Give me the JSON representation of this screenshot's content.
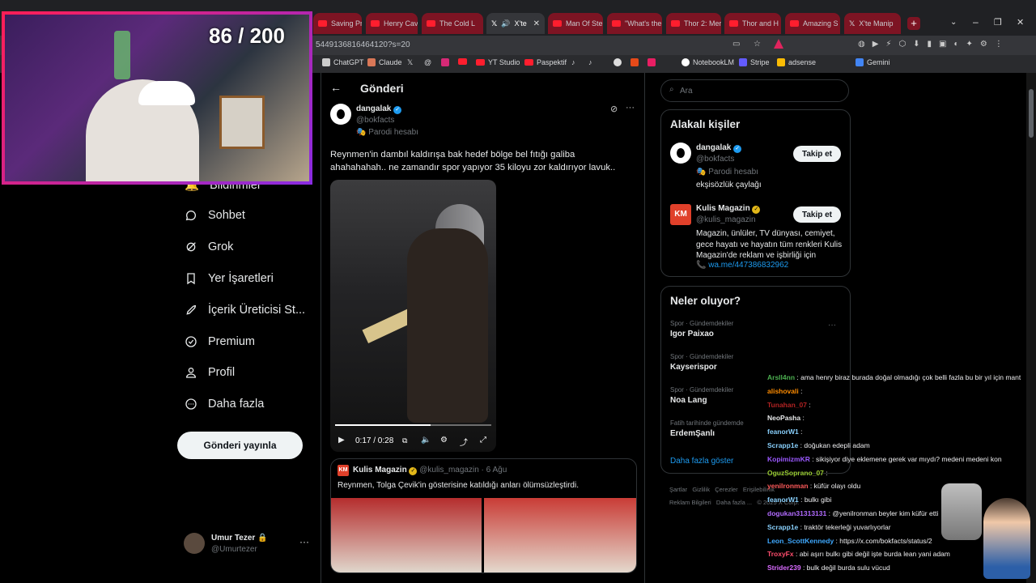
{
  "stream": {
    "counter": "86 / 200"
  },
  "tabs": [
    {
      "label": "Saving Priv",
      "type": "youtube"
    },
    {
      "label": "Henry Cavi",
      "type": "youtube"
    },
    {
      "label": "The Cold L",
      "type": "youtube"
    },
    {
      "label": "X'te",
      "type": "x",
      "active": true
    },
    {
      "label": "Man Of Ste",
      "type": "youtube"
    },
    {
      "label": "\"What's the",
      "type": "youtube"
    },
    {
      "label": "Thor 2: Mer",
      "type": "youtube"
    },
    {
      "label": "Thor and H",
      "type": "youtube"
    },
    {
      "label": "Amazing S",
      "type": "youtube"
    },
    {
      "label": "X'te Manip",
      "type": "x"
    }
  ],
  "address": {
    "url": "5449136816464120?s=20"
  },
  "bookmarks": [
    "ChatGPT",
    "Claude",
    "YT Studio",
    "Paspektif",
    "NotebookLM",
    "Stripe",
    "adsense",
    "Gemini"
  ],
  "nav": {
    "items": [
      "Bildirimler",
      "Sohbet",
      "Grok",
      "Yer İşaretleri",
      "İçerik Üreticisi St...",
      "Premium",
      "Profil",
      "Daha fazla"
    ],
    "post_button": "Gönderi yayınla",
    "account": {
      "name": "Umur Tezer",
      "handle": "@Umurtezer"
    }
  },
  "post": {
    "header": "Gönderi",
    "author": {
      "name": "dangalak",
      "handle": "@bokfacts",
      "label": "Parodi hesabı"
    },
    "text": "Reynmen'in dambıl kaldırışa bak hedef bölge bel fıtığı galiba ahahahahah.. ne zamandır spor yapıyor 35 kiloyu zor kaldırıyor lavuk..",
    "video": {
      "time": "0:17 / 0:28",
      "progress": 0.61
    },
    "quote": {
      "name": "Kulis Magazin",
      "handle": "@kulis_magazin",
      "date": "6 Ağu",
      "text": "Reynmen, Tolga Çevik'in gösterisine katıldığı anları ölümsüzleştirdi."
    }
  },
  "sidebar": {
    "search_placeholder": "Ara",
    "related_title": "Alakalı kişiler",
    "related": [
      {
        "name": "dangalak",
        "handle": "@bokfacts",
        "label": "Parodi hesabı",
        "bio": "ekşisözlük çaylağı",
        "follow": "Takip et"
      },
      {
        "name": "Kulis Magazin",
        "handle": "@kulis_magazin",
        "bio": "Magazin, ünlüler, TV dünyası, cemiyet, gece hayatı ve hayatın tüm renkleri Kulis Magazin'de reklam ve işbirliği için",
        "link": "wa.me/447386832962",
        "follow": "Takip et"
      }
    ],
    "trends_title": "Neler oluyor?",
    "trends": [
      {
        "category": "Spor · Gündemdekiler",
        "name": "Igor Paixao"
      },
      {
        "category": "Spor · Gündemdekiler",
        "name": "Kayserispor"
      },
      {
        "category": "Spor · Gündemdekiler",
        "name": "Noa Lang"
      },
      {
        "category": "Fatih tarihinde gündemde",
        "name": "ErdemŞanlı"
      }
    ],
    "show_more": "Daha fazla göster",
    "footer_1": "Şartlar   Gizlilik   Çerezler   Erişilebilirlik",
    "footer_2": "Reklam Bilgileri   Daha fazla ...   © 2025 X Corp."
  },
  "chat": [
    {
      "user": "Arsll4nn",
      "color": "#4caf50",
      "text": "ama henry biraz burada doğal olmadığı çok belli fazla bu bir yıl için mant"
    },
    {
      "user": "alishovali",
      "color": "#ff8c00",
      "text": ""
    },
    {
      "user": "Tunahan_07",
      "color": "#b22222",
      "text": ""
    },
    {
      "user": "NeoPasha",
      "color": "#e7e9ea",
      "text": ""
    },
    {
      "user": "feanorW1",
      "color": "#87cefa",
      "text": ""
    },
    {
      "user": "Scrapp1e",
      "color": "#87cefa",
      "text": "doğukan edepli adam"
    },
    {
      "user": "KopimizmKR",
      "color": "#9b59ff",
      "text": "sikişiyor diye eklemene gerek var mıydı? medeni medeni kon"
    },
    {
      "user": "OguzSoprano_07",
      "color": "#9acd32",
      "text": ""
    },
    {
      "user": "yenilronman",
      "color": "#ff5a5a",
      "text": "küfür olayı oldu"
    },
    {
      "user": "feanorW1",
      "color": "#87cefa",
      "text": "bulkı gibi"
    },
    {
      "user": "dogukan31313131",
      "color": "#b26bff",
      "text": "@yenilronman beyler kim küfür etti"
    },
    {
      "user": "Scrapp1e",
      "color": "#87cefa",
      "text": "traktör tekerleği yuvarlıyorlar"
    },
    {
      "user": "Leon_ScottKennedy",
      "color": "#3fa9ff",
      "text": "https://x.com/bokfacts/status/2"
    },
    {
      "user": "TroxyFx",
      "color": "#ff4d6d",
      "text": "abi aşırı bulkı gibi değil işte burda lean yani adam"
    },
    {
      "user": "Strider239",
      "color": "#d96bff",
      "text": "bulk değil burda sulu vücud"
    }
  ]
}
